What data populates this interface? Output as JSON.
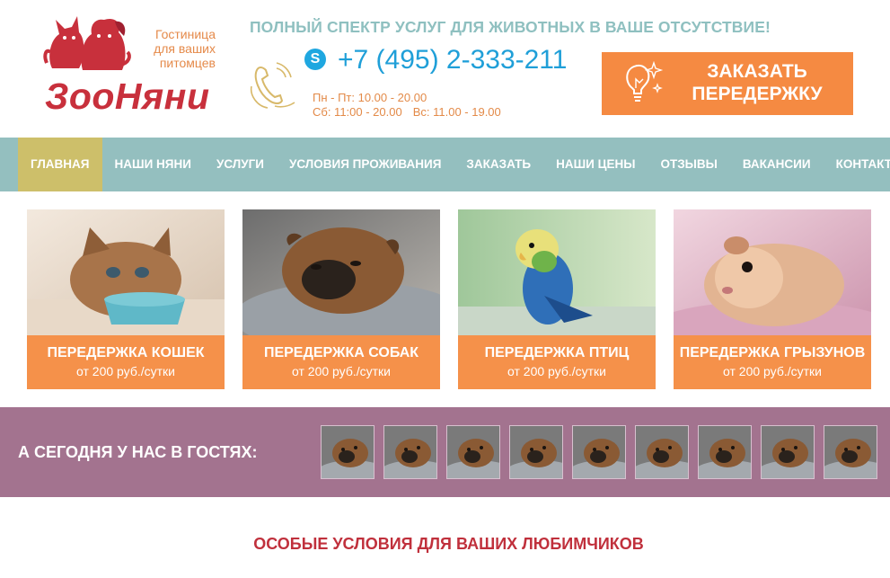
{
  "logo": {
    "tagline": [
      "Гостиница",
      "для ваших",
      "питомцев"
    ],
    "name": "ЗооНяни"
  },
  "header": {
    "slogan": "ПОЛНЫЙ СПЕКТР УСЛУГ ДЛЯ ЖИВОТНЫХ В ВАШЕ ОТСУТСТВИЕ!",
    "skype_glyph": "S",
    "phone": "+7 (495) 2-333-211",
    "hours_line1": "Пн - Пт: 10.00 - 20.00",
    "hours_line2a": "Сб: 11:00 - 20.00",
    "hours_line2b": "Вс: 11.00 - 19.00",
    "order_button": [
      "ЗАКАЗАТЬ",
      "ПЕРЕДЕРЖКУ"
    ]
  },
  "nav": {
    "items": [
      {
        "label": "ГЛАВНАЯ"
      },
      {
        "label": "НАШИ НЯНИ"
      },
      {
        "label": "УСЛУГИ"
      },
      {
        "label": "УСЛОВИЯ ПРОЖИВАНИЯ"
      },
      {
        "label": "ЗАКАЗАТЬ"
      },
      {
        "label": "НАШИ ЦЕНЫ"
      },
      {
        "label": "ОТЗЫВЫ"
      },
      {
        "label": "ВАКАНСИИ"
      },
      {
        "label": "КОНТАКТЫ"
      }
    ],
    "active": "ГЛАВНАЯ"
  },
  "cards": [
    {
      "title": "ПЕРЕДЕРЖКА КОШЕК",
      "price": "от 200 руб./сутки",
      "photo": "kitten-photo"
    },
    {
      "title": "ПЕРЕДЕРЖКА СОБАК",
      "price": "от 200 руб./сутки",
      "photo": "dog-photo"
    },
    {
      "title": "ПЕРЕДЕРЖКА ПТИЦ",
      "price": "от 200 руб./сутки",
      "photo": "parrot-photo"
    },
    {
      "title": "ПЕРЕДЕРЖКА ГРЫЗУНОВ",
      "price": "от 200 руб./сутки",
      "photo": "guinea-pig-photo"
    }
  ],
  "guests": {
    "title": "А СЕГОДНЯ У НАС В ГОСТЯХ:",
    "thumb_count": 9
  },
  "section": {
    "title": "ОСОБЫЕ УСЛОВИЯ ДЛЯ ВАШИХ ЛЮБИМЧИКОВ"
  },
  "colors": {
    "nav_bg": "#94bfbf",
    "nav_active": "#cdbf6a",
    "orange": "#f58a42",
    "guests_bg": "#a3738f",
    "brand_red": "#c8303c",
    "phone_blue": "#1f9fd8"
  }
}
